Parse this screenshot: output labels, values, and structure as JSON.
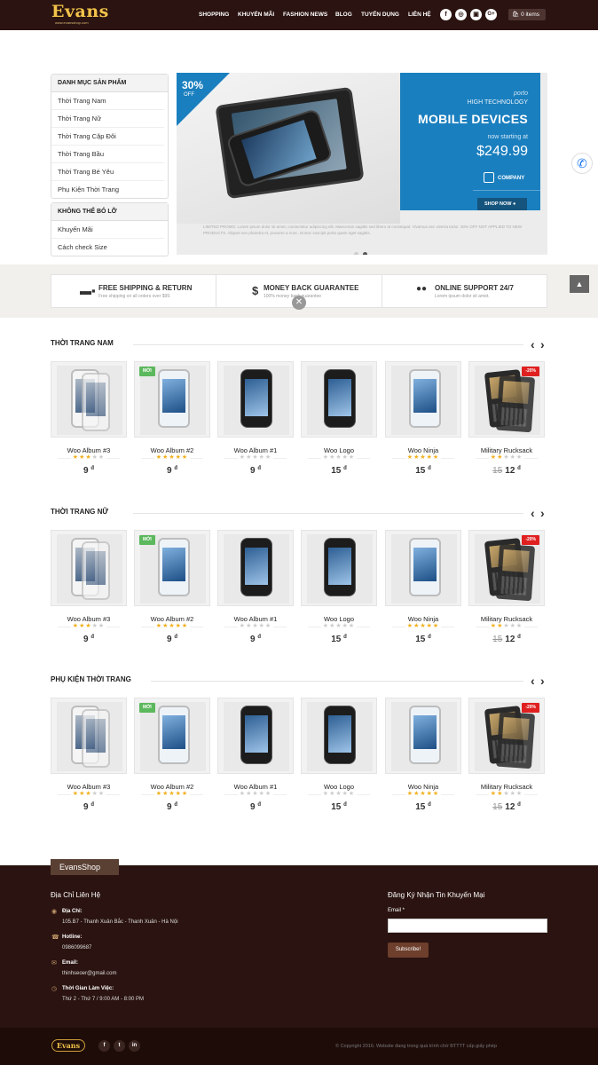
{
  "header": {
    "logo": "Evans",
    "logo_sub": "www.evansshop.com",
    "nav": [
      "SHOPPING",
      "KHUYẾN MÃI",
      "FASHION NEWS",
      "BLOG",
      "TUYỂN DỤNG",
      "LIÊN HỆ"
    ],
    "social": [
      "f",
      "◎",
      "▣",
      "G+"
    ],
    "cart": "0 items"
  },
  "sidebar": {
    "cat_title": "DANH MỤC SẢN PHẨM",
    "categories": [
      "Thời Trang Nam",
      "Thời Trang Nữ",
      "Thời Trang Cặp Đôi",
      "Thời Trang Bầu",
      "Thời Trang Bé Yêu",
      "Phụ Kiện Thời Trang"
    ],
    "extra_title": "KHÔNG THỂ BỎ LỠ",
    "extras": [
      "Khuyến Mãi",
      "Cách check Size"
    ]
  },
  "banner": {
    "badge_pct": "30%",
    "badge_off": "OFF",
    "brand": "porto",
    "tagline": "HIGH TECHNOLOGY",
    "headline": "MOBILE DEVICES",
    "from": "now starting at",
    "price": "$249.99",
    "company": "COMPANY",
    "cta": "SHOP NOW",
    "promo": "LIMITED PROMO: Lorem ipsum dolor sit amet, consectetur adipiscing elit. Maecenas sagittis sed libero at consequat. Vivamus nec viverra tortor. 30% OFF NOT APPLIED TO NEW PRODUCTS. Aliquet non pharetra et, posuere a nunc. Donec suscipit porta quam eget sagittis."
  },
  "features": [
    {
      "icon": "truck-icon",
      "glyph": "🚚",
      "title": "FREE SHIPPING & RETURN",
      "sub": "Free shipping on all orders over $99."
    },
    {
      "icon": "dollar-icon",
      "glyph": "$",
      "title": "MONEY BACK GUARANTEE",
      "sub": "100% money back guarantee"
    },
    {
      "icon": "chat-icon",
      "glyph": "💬",
      "title": "ONLINE SUPPORT 24/7",
      "sub": "Lorem ipsum dolor sit amet."
    }
  ],
  "sections": [
    {
      "title": "THỜI TRANG NAM"
    },
    {
      "title": "THỜI TRANG NỮ"
    },
    {
      "title": "PHỤ KIỆN THỜI TRANG"
    }
  ],
  "products": [
    {
      "name": "Woo Album #3",
      "rating": 3,
      "price": "9",
      "old": "",
      "tag": "",
      "kind": "white"
    },
    {
      "name": "Woo Album #2",
      "rating": 4.5,
      "price": "9",
      "old": "",
      "tag": "MỚI",
      "kind": "galaxy-white"
    },
    {
      "name": "Woo Album #1",
      "rating": 0,
      "price": "9",
      "old": "",
      "tag": "",
      "kind": "galaxy-black"
    },
    {
      "name": "Woo Logo",
      "rating": 0,
      "price": "15",
      "old": "",
      "tag": "",
      "kind": "galaxy-black"
    },
    {
      "name": "Woo Ninja",
      "rating": 4.5,
      "price": "15",
      "old": "",
      "tag": "",
      "kind": "galaxy-white"
    },
    {
      "name": "Military Rucksack",
      "rating": 2,
      "price": "12",
      "old": "15",
      "tag": "-20%",
      "kind": "blackberry"
    }
  ],
  "currency": "đ",
  "footer": {
    "tab": "EvansShop",
    "contact_title": "Địa Chỉ Liên Hệ",
    "address_label": "Địa Chỉ:",
    "address": "105.B7 - Thanh Xuân Bắc - Thanh Xuân - Hà Nội",
    "hotline_label": "Hotline:",
    "hotline": "0986099687",
    "email_label": "Email:",
    "email": "thinhseoer@gmail.com",
    "hours_label": "Thời Gian Làm Việc:",
    "hours": "Thứ 2 - Thứ 7 / 9:00 AM - 8:00 PM",
    "newsletter_title": "Đăng Ký Nhận Tin Khuyến Mại",
    "email_field_label": "Email *",
    "subscribe": "Subscribe!",
    "bottom_logo": "Evans",
    "bottom_social": [
      "f",
      "t",
      "in"
    ],
    "copyright": "© Copyright 2016. Website đang trong quá trình chờ BTTTT cấp giấy phép"
  }
}
